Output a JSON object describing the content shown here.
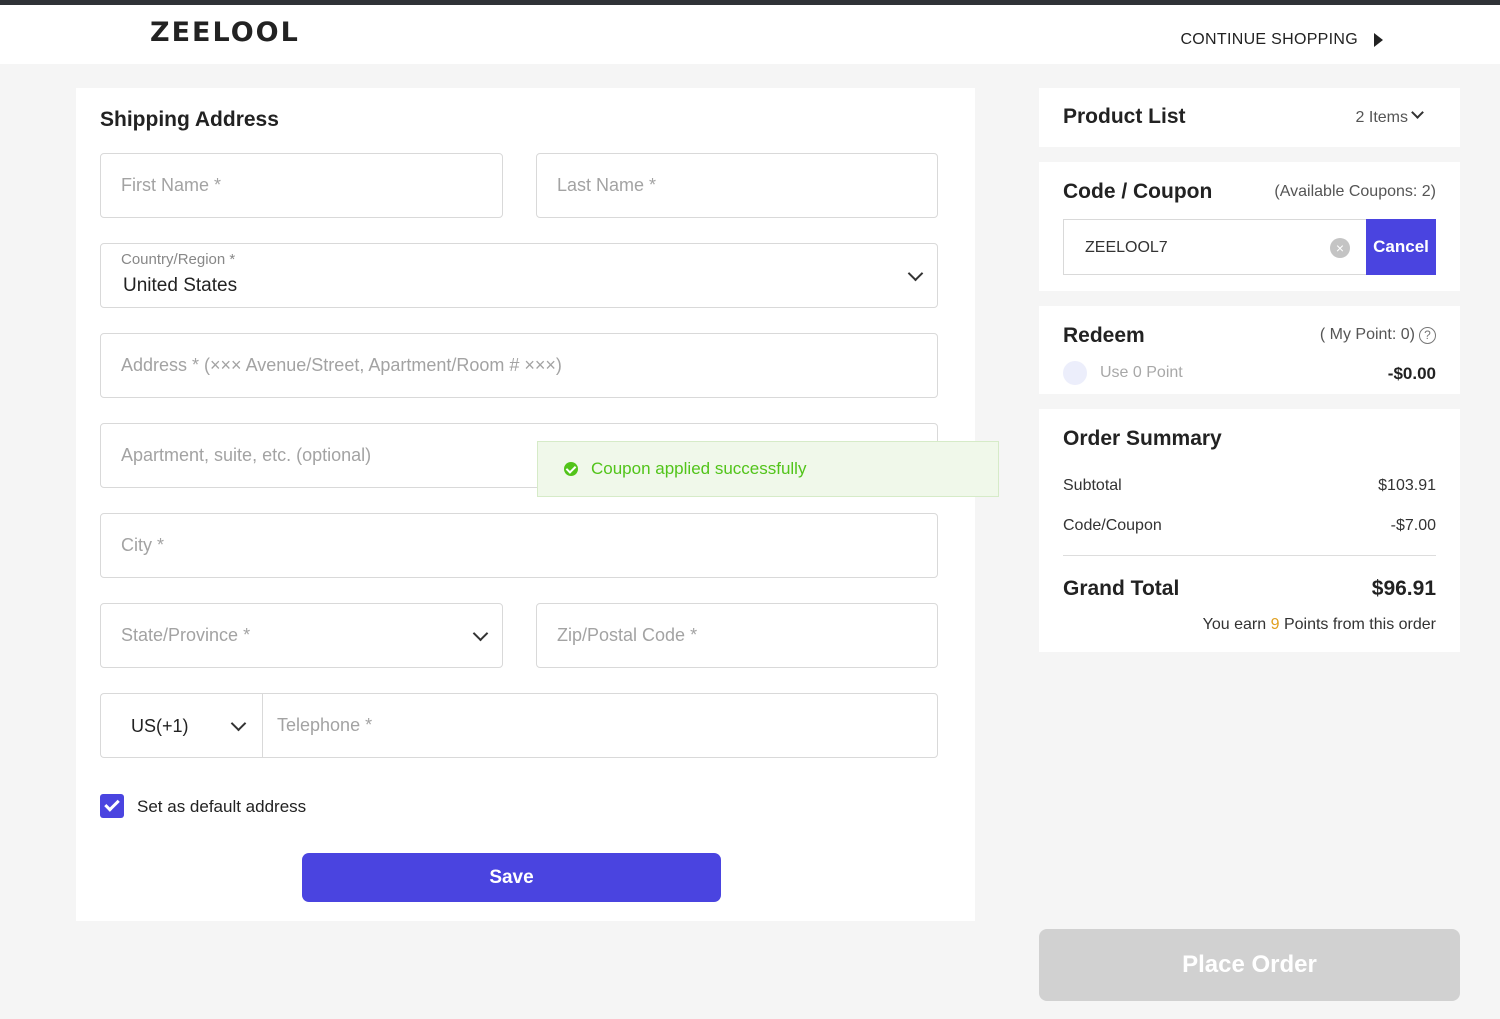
{
  "header": {
    "logo": "ZEELOOL",
    "continue_label": "CONTINUE SHOPPING"
  },
  "shipping": {
    "title": "Shipping Address",
    "first_name_placeholder": "First Name *",
    "last_name_placeholder": "Last Name *",
    "country_label": "Country/Region *",
    "country_value": "United States",
    "address_placeholder": "Address * (××× Avenue/Street, Apartment/Room # ×××)",
    "apartment_placeholder": "Apartment, suite, etc. (optional)",
    "city_placeholder": "City *",
    "state_placeholder": "State/Province *",
    "zip_placeholder": "Zip/Postal Code *",
    "phone_code": "US(+1)",
    "telephone_placeholder": "Telephone *",
    "default_label": "Set as default address",
    "default_checked": true,
    "save_label": "Save"
  },
  "toast": {
    "message": "Coupon applied successfully",
    "color": "#52c41a"
  },
  "product_list": {
    "title": "Product List",
    "count": "2 Items"
  },
  "coupon": {
    "title": "Code / Coupon",
    "available": "(Available Coupons: 2)",
    "code_value": "ZEELOOL7",
    "cancel_label": "Cancel"
  },
  "redeem": {
    "title": "Redeem",
    "my_point": "( My Point: 0)",
    "use_point": "Use 0 Point",
    "amount": "-$0.00"
  },
  "summary": {
    "title": "Order Summary",
    "subtotal_label": "Subtotal",
    "subtotal_value": "$103.91",
    "coupon_label": "Code/Coupon",
    "coupon_value": "-$7.00",
    "grand_label": "Grand Total",
    "grand_value": "$96.91",
    "earn_prefix": "You earn",
    "earn_points": "9",
    "earn_suffix": "Points from this order"
  },
  "place_order_label": "Place Order",
  "colors": {
    "accent": "#4a44e0",
    "disabled": "#d1d1d1",
    "points": "#e0a020"
  }
}
